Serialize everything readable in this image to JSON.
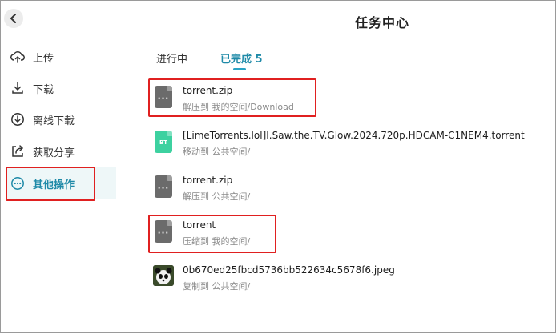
{
  "header": {
    "title": "任务中心",
    "back_icon": "chevron-left-icon"
  },
  "sidebar": {
    "items": [
      {
        "label": "上传",
        "icon": "upload-icon"
      },
      {
        "label": "下载",
        "icon": "download-icon"
      },
      {
        "label": "离线下载",
        "icon": "offline-download-icon"
      },
      {
        "label": "获取分享",
        "icon": "share-icon"
      },
      {
        "label": "其他操作",
        "icon": "more-icon",
        "active": true
      }
    ]
  },
  "tabs": [
    {
      "label": "进行中"
    },
    {
      "label": "已完成 5",
      "active": true
    }
  ],
  "tasks": [
    {
      "name": "torrent.zip",
      "detail": "解压到 我的空间/Download",
      "icon": "zip-file-icon"
    },
    {
      "name": "[LimeTorrents.lol]I.Saw.the.TV.Glow.2024.720p.HDCAM-C1NEM4.torrent",
      "detail": "移动到 公共空间/",
      "icon": "bt-file-icon",
      "icon_label": "BT"
    },
    {
      "name": "torrent.zip",
      "detail": "解压到 公共空间/",
      "icon": "zip-file-icon"
    },
    {
      "name": "torrent",
      "detail": "压缩到 我的空间/",
      "icon": "zip-file-icon"
    },
    {
      "name": "0b670ed25fbcd5736bb522634c5678f6.jpeg",
      "detail": "复制到 公共空间/",
      "icon": "image-thumbnail"
    }
  ],
  "colors": {
    "accent": "#1f8aa8",
    "highlight_box": "#e02020",
    "bt_icon": "#3dd1a0",
    "file_icon": "#6b6b6b"
  }
}
